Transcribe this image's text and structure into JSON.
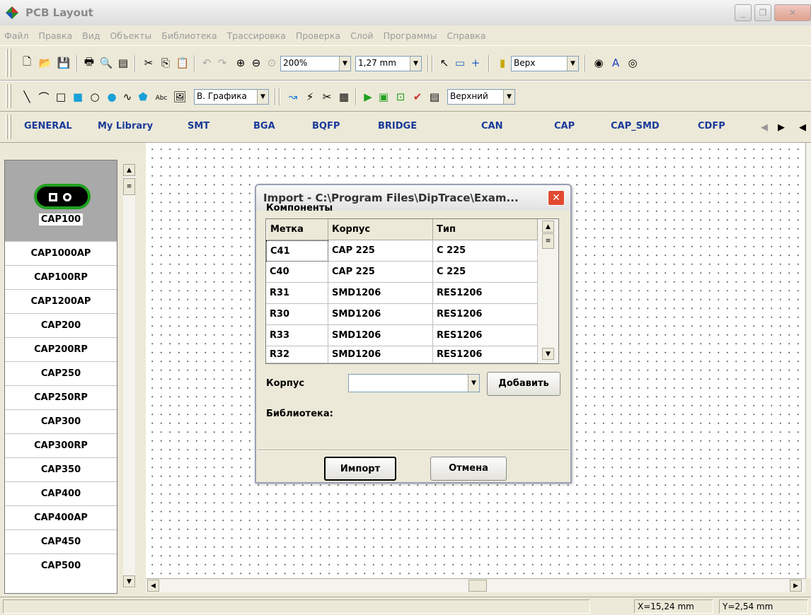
{
  "window": {
    "title": "PCB Layout"
  },
  "menu": [
    "Файл",
    "Правка",
    "Вид",
    "Объекты",
    "Библиотека",
    "Трассировка",
    "Проверка",
    "Слой",
    "Программы",
    "Справка"
  ],
  "toolbar1": {
    "zoom": "200%",
    "grid": "1,27 mm",
    "layer": "Верх"
  },
  "toolbar2": {
    "abc": "Abc",
    "graphics_layer": "В. Графика",
    "side": "Верхний"
  },
  "library_tabs": [
    "GENERAL",
    "My Library",
    "SMT",
    "BGA",
    "BQFP",
    "BRIDGE",
    "CAN",
    "CAP",
    "CAP_SMD",
    "CDFP"
  ],
  "components": {
    "selected": "CAP100",
    "items": [
      "CAP1000AP",
      "CAP100RP",
      "CAP1200AP",
      "CAP200",
      "CAP200RP",
      "CAP250",
      "CAP250RP",
      "CAP300",
      "CAP300RP",
      "CAP350",
      "CAP400",
      "CAP400AP",
      "CAP450",
      "CAP500"
    ]
  },
  "dialog": {
    "title": "Import - C:\\Program Files\\DipTrace\\Exam...",
    "components_label": "Компоненты",
    "columns": [
      "Метка",
      "Корпус",
      "Тип"
    ],
    "rows": [
      [
        "C41",
        "CAP 225",
        "C 225"
      ],
      [
        "C40",
        "CAP 225",
        "C 225"
      ],
      [
        "R31",
        "SMD1206",
        "RES1206"
      ],
      [
        "R30",
        "SMD1206",
        "RES1206"
      ],
      [
        "R33",
        "SMD1206",
        "RES1206"
      ],
      [
        "R32",
        "SMD1206",
        "RES1206"
      ]
    ],
    "package_label": "Корпус",
    "package_value": "",
    "add_button": "Добавить",
    "library_label": "Библиотека:",
    "import_button": "Импорт",
    "cancel_button": "Отмена"
  },
  "status": {
    "x": "X=15,24 mm",
    "y": "Y=2,54 mm"
  }
}
